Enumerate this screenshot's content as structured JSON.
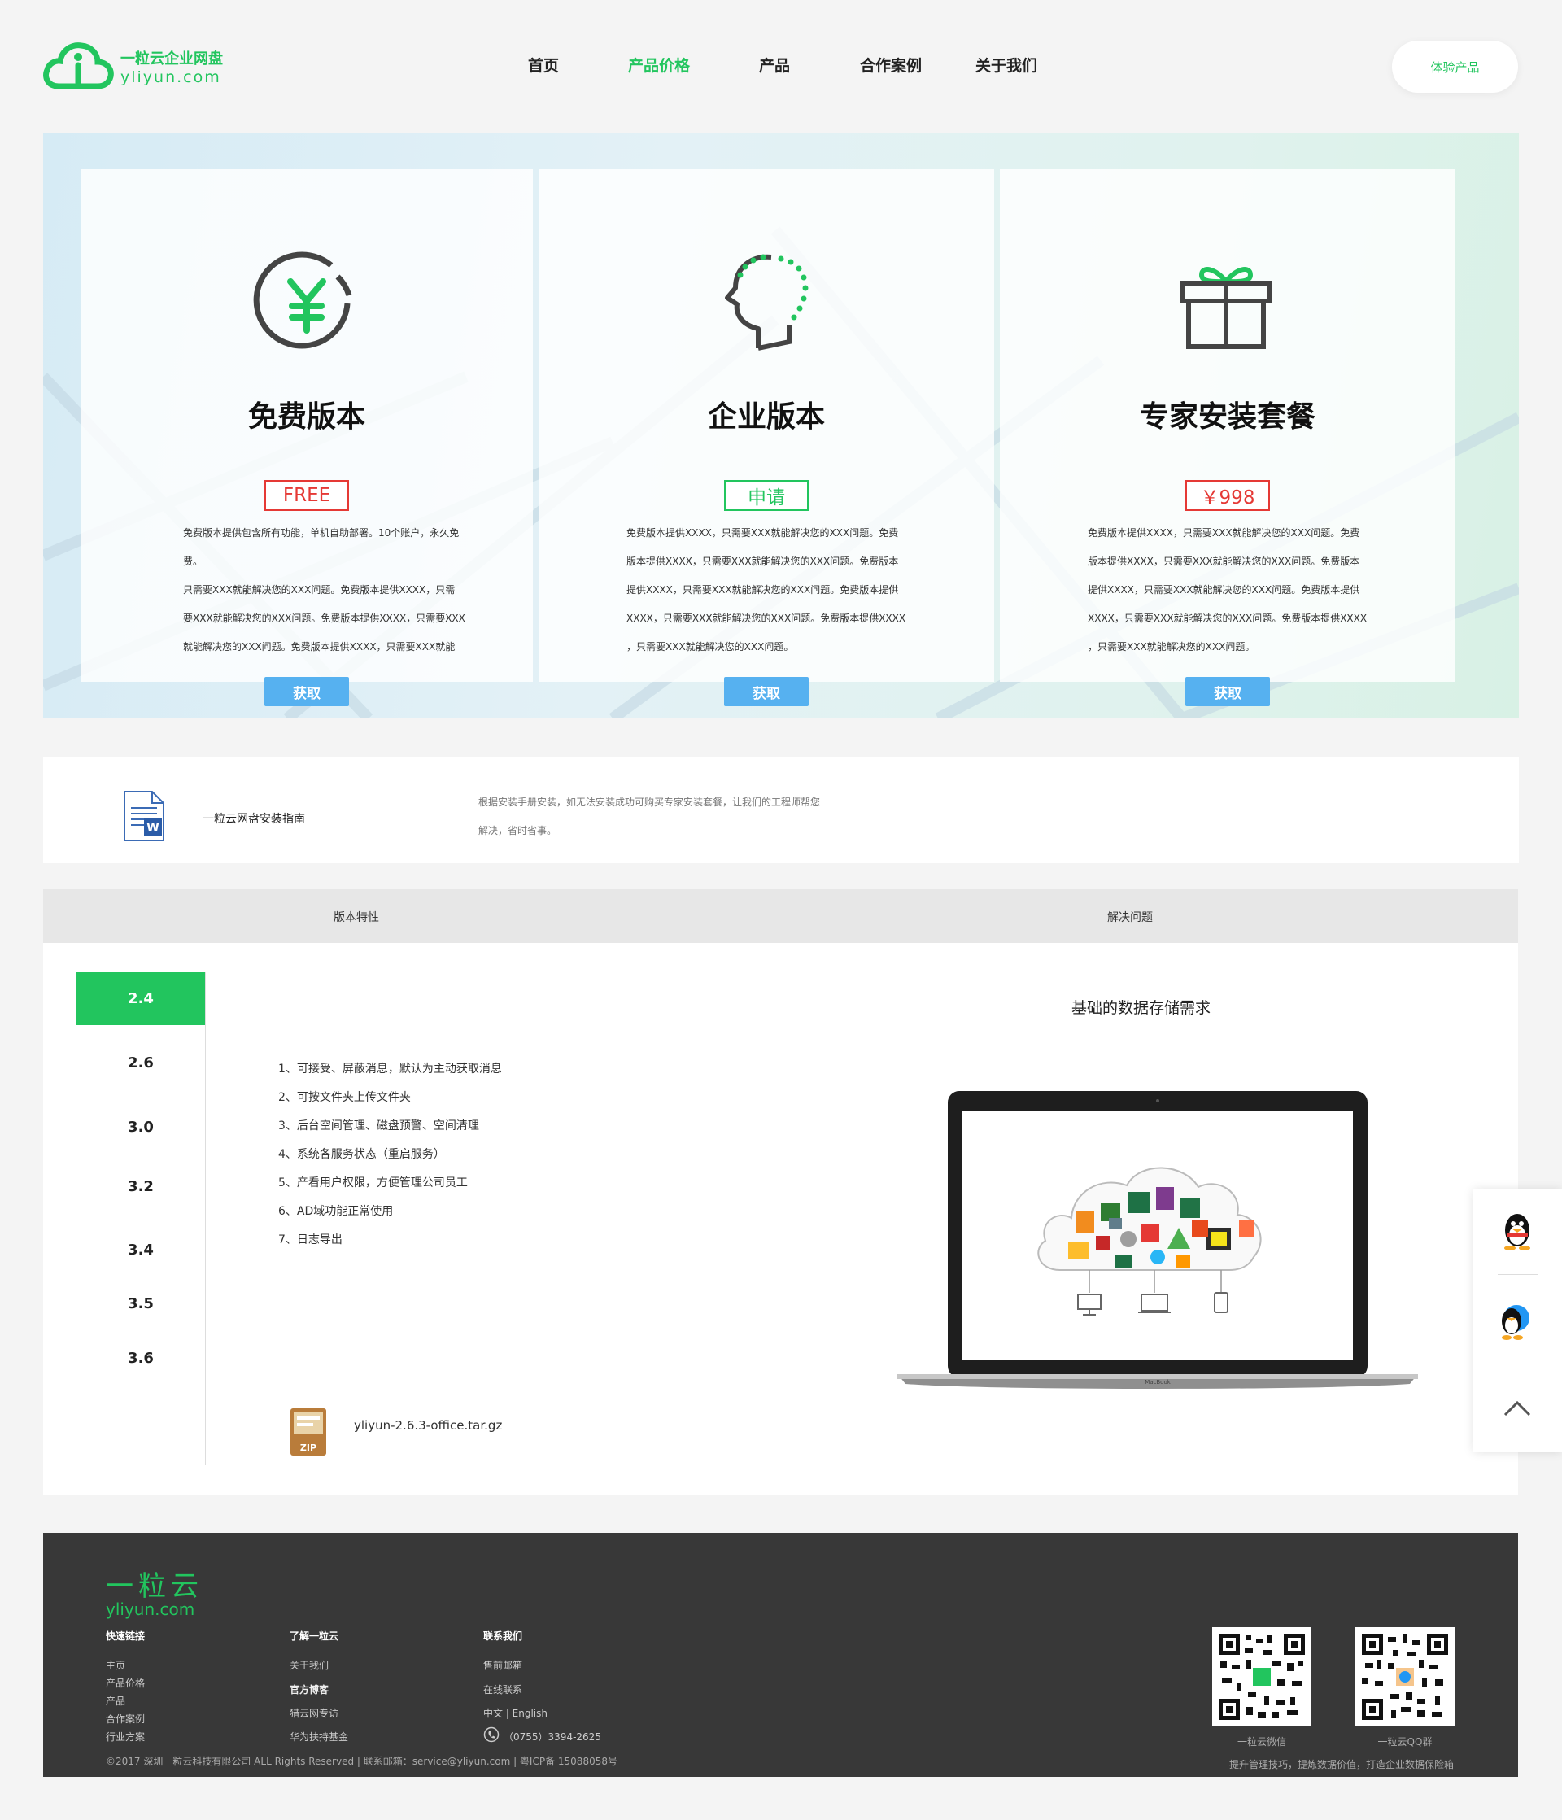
{
  "header": {
    "logo_cn": "一粒云企业网盘",
    "logo_en": "yliyun.com",
    "nav": [
      {
        "label": "首页"
      },
      {
        "label": "产品价格"
      },
      {
        "label": "产品"
      },
      {
        "label": "合作案例"
      },
      {
        "label": "关于我们"
      }
    ],
    "trial_button": "体验产品"
  },
  "plans": [
    {
      "icon": "yen-icon",
      "title": "免费版本",
      "price": "FREE",
      "price_color": "#e53935",
      "desc": [
        "免费版本提供包含所有功能，单机自助部署。10个账户，永久免",
        "费。",
        "只需要XXX就能解决您的XXX问题。免费版本提供XXXX，只需",
        "要XXX就能解决您的XXX问题。免费版本提供XXXX，只需要XXX",
        "就能解决您的XXX问题。免费版本提供XXXX，只需要XXX就能"
      ],
      "button": "获取"
    },
    {
      "icon": "head-icon",
      "title": "企业版本",
      "price": "申请",
      "price_color": "#22c55e",
      "desc": [
        "免费版本提供XXXX，只需要XXX就能解决您的XXX问题。免费",
        "版本提供XXXX，只需要XXX就能解决您的XXX问题。免费版本",
        "提供XXXX，只需要XXX就能解决您的XXX问题。免费版本提供",
        "XXXX，只需要XXX就能解决您的XXX问题。免费版本提供XXXX",
        "，只需要XXX就能解决您的XXX问题。"
      ],
      "button": "获取"
    },
    {
      "icon": "gift-icon",
      "title": "专家安装套餐",
      "price": "￥998",
      "price_color": "#e53935",
      "desc": [
        "免费版本提供XXXX，只需要XXX就能解决您的XXX问题。免费",
        "版本提供XXXX，只需要XXX就能解决您的XXX问题。免费版本",
        "提供XXXX，只需要XXX就能解决您的XXX问题。免费版本提供",
        "XXXX，只需要XXX就能解决您的XXX问题。免费版本提供XXXX",
        "，只需要XXX就能解决您的XXX问题。"
      ],
      "button": "获取"
    }
  ],
  "guide": {
    "title": "一粒云网盘安装指南",
    "desc_1": "根据安装手册安装，如无法安装成功可购买专家安装套餐，让我们的工程师帮您",
    "desc_2": "解决，省时省事。"
  },
  "tabs": [
    {
      "label": "版本特性"
    },
    {
      "label": "解决问题"
    }
  ],
  "versions": [
    "2.4",
    "2.6",
    "3.0",
    "3.2",
    "3.4",
    "3.5",
    "3.6"
  ],
  "active_version": "2.4",
  "features": [
    "1、可接受、屏蔽消息，默认为主动获取消息",
    "2、可按文件夹上传文件夹",
    "3、后台空间管理、磁盘预警、空间清理",
    "4、系统各服务状态（重启服务）",
    "5、产看用户权限，方便管理公司员工",
    "6、AD域功能正常使用",
    "7、日志导出"
  ],
  "solution_heading": "基础的数据存储需求",
  "laptop_brand": "MacBook",
  "download": {
    "filename": "yliyun-2.6.3-office.tar.gz",
    "icon_label": "ZIP"
  },
  "footer": {
    "logo_cn": "一粒云",
    "logo_en": "yliyun.com",
    "col1_title": "快速链接",
    "col1_links": [
      "主页",
      "产品价格",
      "产品",
      "合作案例",
      "行业方案"
    ],
    "col2_title": "了解一粒云",
    "col2_links": [
      "关于我们",
      "官方博客",
      "猎云网专访",
      "华为扶持基金"
    ],
    "col3_title": "联系我们",
    "col3_links": [
      "售前邮箱",
      "在线联系",
      "中文 | English",
      "（0755）3394-2625"
    ],
    "qr_wechat_caption": "一粒云微信",
    "qr_qq_caption": "一粒云QQ群",
    "copyright": "©2017  深圳一粒云科技有限公司  ALL Rights Reserved | 联系邮箱：service@yliyun.com | 粤ICP备 15088058号",
    "slogan": "提升管理技巧，提炼数据价值，打造企业数据保险箱"
  },
  "colors": {
    "brand_green": "#22c55e",
    "button_blue": "#56b1f0",
    "price_red": "#e53935",
    "footer_bg": "#383838"
  }
}
